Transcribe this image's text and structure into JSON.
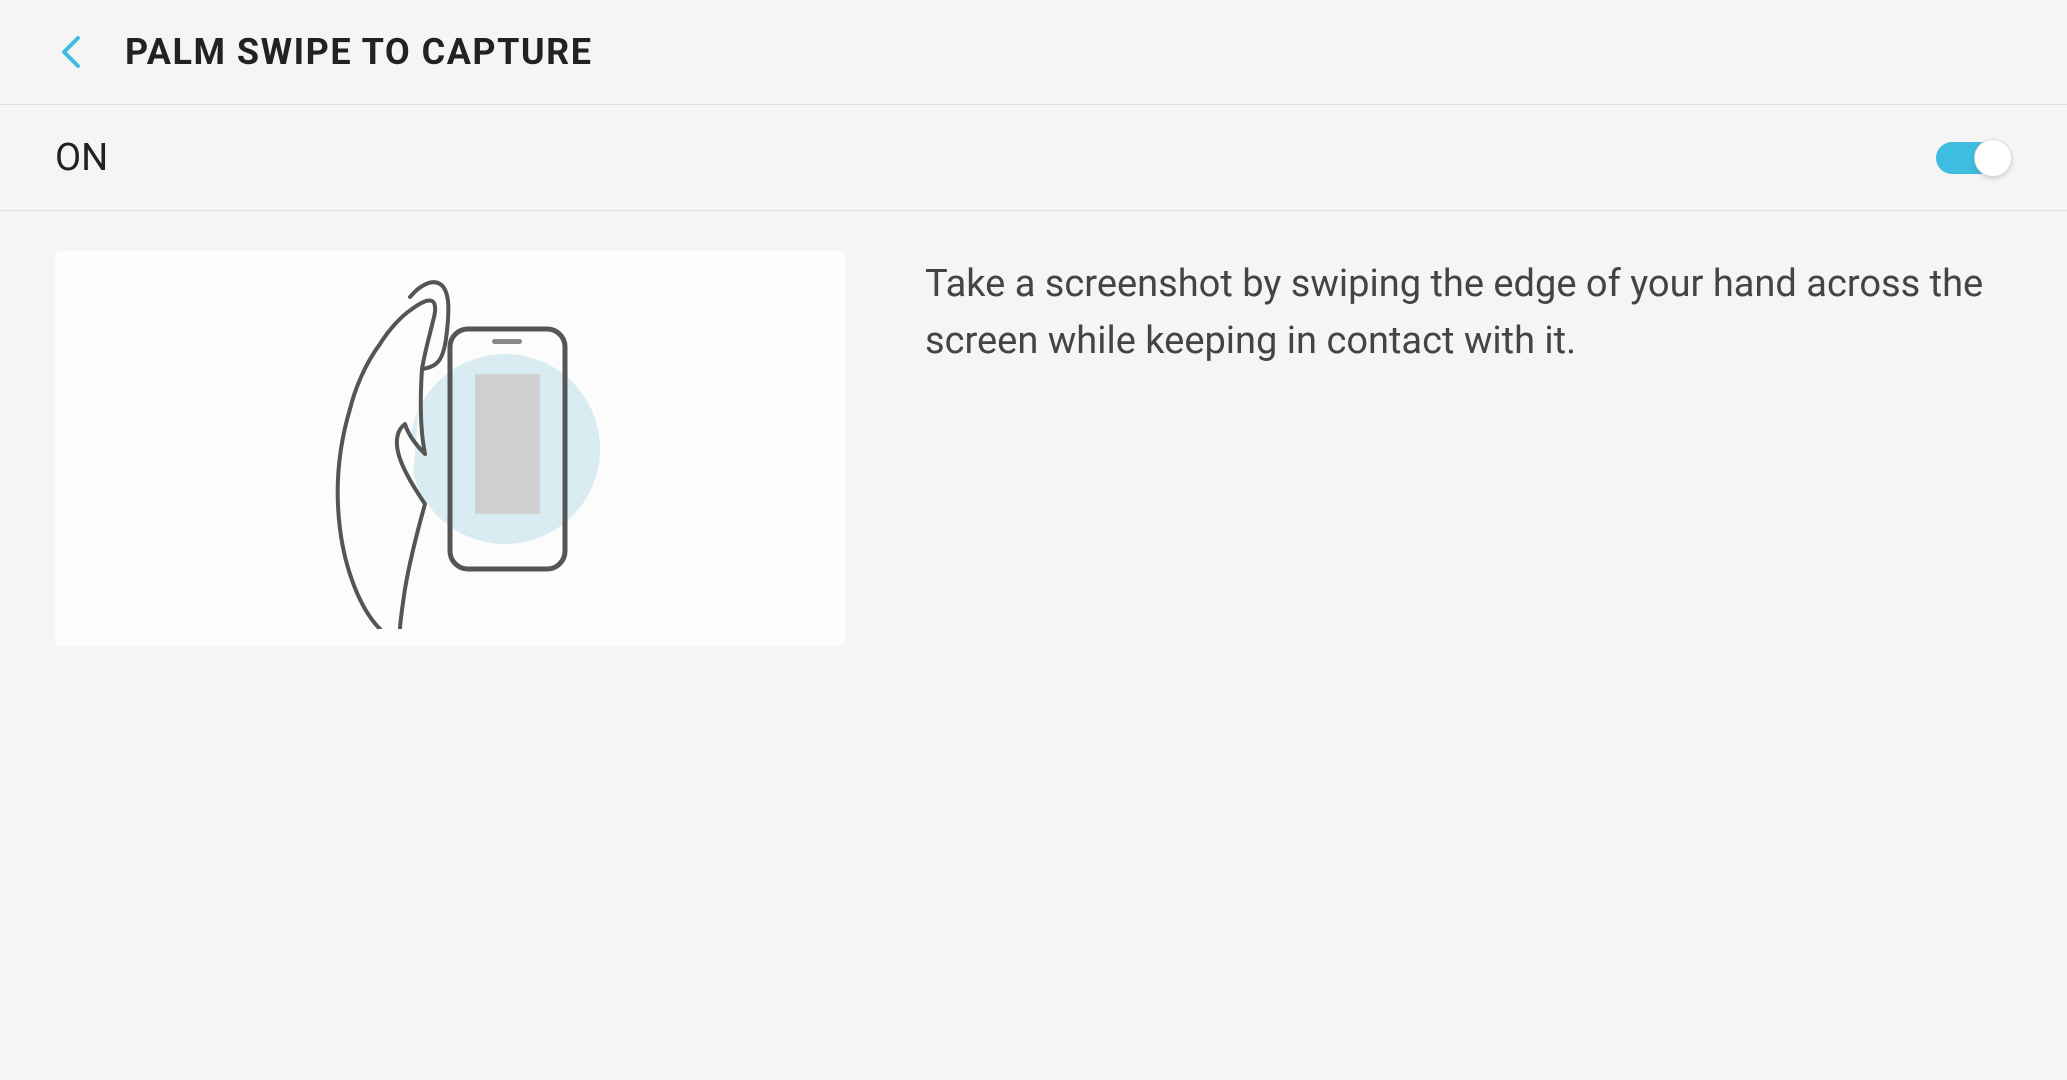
{
  "header": {
    "title": "PALM SWIPE TO CAPTURE"
  },
  "toggle": {
    "state_label": "ON",
    "enabled": true
  },
  "content": {
    "description": "Take a screenshot by swiping the edge of your hand across the screen while keeping in contact with it."
  },
  "colors": {
    "accent": "#3ebde0",
    "text_primary": "#222",
    "text_secondary": "#444",
    "background": "#f5f5f5",
    "divider": "#e0e0e0"
  }
}
